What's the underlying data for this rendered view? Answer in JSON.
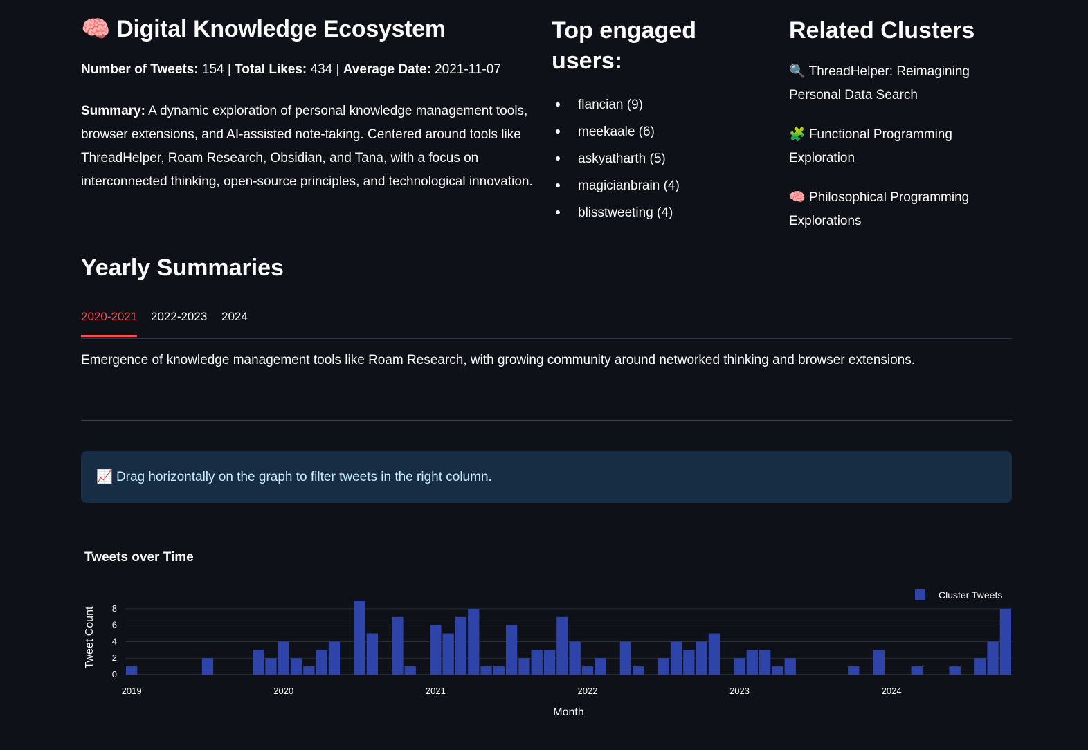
{
  "header": {
    "emoji": "🧠",
    "title": "Digital Knowledge Ecosystem"
  },
  "stats": {
    "tweets_label": "Number of Tweets:",
    "tweets_value": "154",
    "likes_label": "Total Likes:",
    "likes_value": "434",
    "date_label": "Average Date:",
    "date_value": "2021-11-07",
    "separator": "|"
  },
  "summary": {
    "label": "Summary:",
    "text_1": " A dynamic exploration of personal knowledge management tools, browser extensions, and AI-assisted note-taking. Centered around tools like ",
    "link_1": "ThreadHelper",
    "sep_1": ", ",
    "link_2": "Roam Research",
    "sep_2": ", ",
    "link_3": "Obsidian",
    "sep_3": ", and ",
    "link_4": "Tana",
    "text_2": ", with a focus on interconnected thinking, open-source principles, and technological innovation."
  },
  "top_users": {
    "title": "Top engaged users:",
    "items": [
      "flancian (9)",
      "meekaale (6)",
      "askyatharth (5)",
      "magicianbrain (4)",
      "blisstweeting (4)"
    ]
  },
  "related": {
    "title": "Related Clusters",
    "items": [
      {
        "emoji": "🔍",
        "label": "ThreadHelper: Reimagining Personal Data Search"
      },
      {
        "emoji": "🧩",
        "label": "Functional Programming Exploration"
      },
      {
        "emoji": "🧠",
        "label": "Philosophical Programming Explorations"
      }
    ]
  },
  "yearly": {
    "title": "Yearly Summaries",
    "tabs": [
      "2020-2021",
      "2022-2023",
      "2024"
    ],
    "active_tab": 0,
    "content": "Emergence of knowledge management tools like Roam Research, with growing community around networked thinking and browser extensions."
  },
  "info": {
    "emoji": "📈",
    "text": "Drag horizontally on the graph to filter tweets in the right column."
  },
  "chart_data": {
    "type": "bar",
    "title": "Tweets over Time",
    "xlabel": "Month",
    "ylabel": "Tweet Count",
    "ylim": [
      0,
      9
    ],
    "yticks": [
      0,
      2,
      4,
      6,
      8
    ],
    "xticks": [
      "2019",
      "2020",
      "2021",
      "2022",
      "2023",
      "2024"
    ],
    "grid": true,
    "legend": "top-right",
    "series": [
      {
        "name": "Cluster Tweets",
        "color": "#2f44a8",
        "points": [
          [
            "2019-01",
            1
          ],
          [
            "2019-07",
            2
          ],
          [
            "2019-11",
            3
          ],
          [
            "2019-12",
            2
          ],
          [
            "2020-01",
            4
          ],
          [
            "2020-02",
            2
          ],
          [
            "2020-03",
            1
          ],
          [
            "2020-04",
            3
          ],
          [
            "2020-05",
            4
          ],
          [
            "2020-07",
            9
          ],
          [
            "2020-08",
            5
          ],
          [
            "2020-10",
            7
          ],
          [
            "2020-11",
            1
          ],
          [
            "2021-01",
            6
          ],
          [
            "2021-02",
            5
          ],
          [
            "2021-03",
            7
          ],
          [
            "2021-04",
            8
          ],
          [
            "2021-05",
            1
          ],
          [
            "2021-06",
            1
          ],
          [
            "2021-07",
            6
          ],
          [
            "2021-08",
            2
          ],
          [
            "2021-09",
            3
          ],
          [
            "2021-10",
            3
          ],
          [
            "2021-11",
            7
          ],
          [
            "2021-12",
            4
          ],
          [
            "2022-01",
            1
          ],
          [
            "2022-02",
            2
          ],
          [
            "2022-04",
            4
          ],
          [
            "2022-05",
            1
          ],
          [
            "2022-07",
            2
          ],
          [
            "2022-08",
            4
          ],
          [
            "2022-09",
            3
          ],
          [
            "2022-10",
            4
          ],
          [
            "2022-11",
            5
          ],
          [
            "2023-01",
            2
          ],
          [
            "2023-02",
            3
          ],
          [
            "2023-03",
            3
          ],
          [
            "2023-04",
            1
          ],
          [
            "2023-05",
            2
          ],
          [
            "2023-10",
            1
          ],
          [
            "2023-12",
            3
          ],
          [
            "2024-03",
            1
          ],
          [
            "2024-06",
            1
          ],
          [
            "2024-08",
            2
          ],
          [
            "2024-09",
            4
          ],
          [
            "2024-10",
            8
          ]
        ]
      }
    ]
  }
}
